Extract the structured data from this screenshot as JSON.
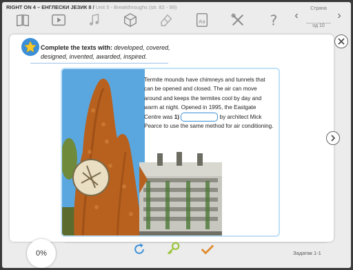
{
  "window": {
    "title_bold": "RIGHT ON 4 – ЕНГЛЕСКИ ЈЕЗИК 8 /",
    "title_sub": "Unit 5 - Breakthroughs (str. 82 - 99)"
  },
  "toolbar": {
    "icons": [
      "book-icon",
      "video-icon",
      "music-note-icon",
      "cube-icon",
      "eraser-icon",
      "dictionary-icon",
      "tools-icon",
      "help-icon"
    ]
  },
  "pager": {
    "label": "Страна",
    "of": "од 10"
  },
  "exercise": {
    "instruction_bold": "Complete the texts with:",
    "instruction_words": "developed, covered, designed, invented, awarded, inspired.",
    "text_before": "Termite mounds have chimneys and tunnels that can be opened and closed. The air can move around and keeps the termites cool by day and warm at night. Opened in 1995, the Eastgate Centre was",
    "gap_number": "1)",
    "text_after": "by architect Mick Pearce to use the same method for air conditioning."
  },
  "bottom": {
    "progress": "0%",
    "task_label": "Задатак 1-1"
  },
  "colors": {
    "accent_blue": "#3a8fd8",
    "star_yellow": "#f7c829",
    "card_border": "#bfe0f7",
    "check_orange": "#e08a2c",
    "key_green": "#9ac43c"
  }
}
